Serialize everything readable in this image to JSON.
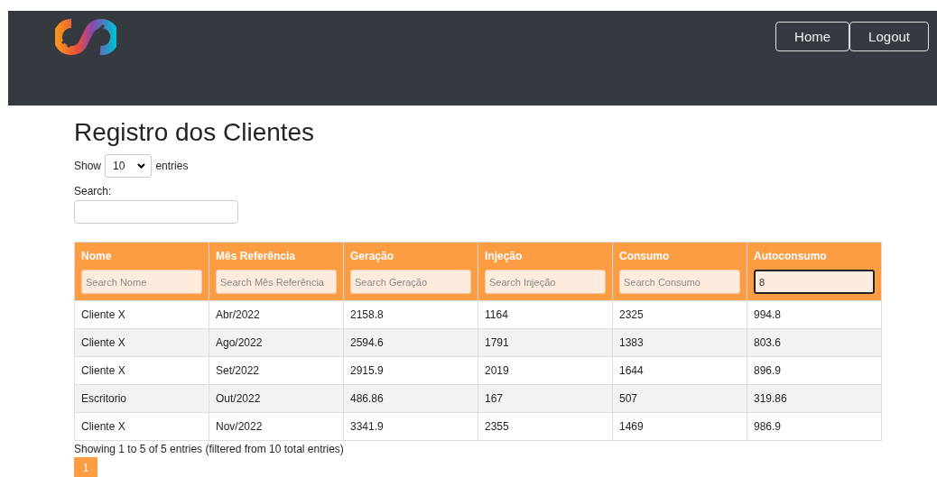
{
  "nav": {
    "buttons": [
      "Home",
      "Logout"
    ]
  },
  "title": "Registro dos Clientes",
  "length": {
    "show": "Show",
    "value": "10",
    "entries": "entries"
  },
  "search": {
    "label": "Search:"
  },
  "table": {
    "columns": [
      {
        "label": "Nome",
        "placeholder": "Search Nome"
      },
      {
        "label": "Mês Referência",
        "placeholder": "Search Mês Referência"
      },
      {
        "label": "Geração",
        "placeholder": "Search Geração"
      },
      {
        "label": "Injeção",
        "placeholder": "Search Injeção"
      },
      {
        "label": "Consumo",
        "placeholder": "Search Consumo"
      },
      {
        "label": "Autoconsumo",
        "value": "8",
        "focused": true
      }
    ],
    "rows": [
      [
        "Cliente X",
        "Abr/2022",
        "2158.8",
        "1164",
        "2325",
        "994.8"
      ],
      [
        "Cliente X",
        "Ago/2022",
        "2594.6",
        "1791",
        "1383",
        "803.6"
      ],
      [
        "Cliente X",
        "Set/2022",
        "2915.9",
        "2019",
        "1644",
        "896.9"
      ],
      [
        "Escritorio",
        "Out/2022",
        "486.86",
        "167",
        "507",
        "319.86"
      ],
      [
        "Cliente X",
        "Nov/2022",
        "3341.9",
        "2355",
        "1469",
        "986.9"
      ]
    ]
  },
  "info": "Showing 1 to 5 of 5 entries (filtered from 10 total entries)",
  "pages": [
    {
      "label": "1",
      "selected": true
    }
  ]
}
